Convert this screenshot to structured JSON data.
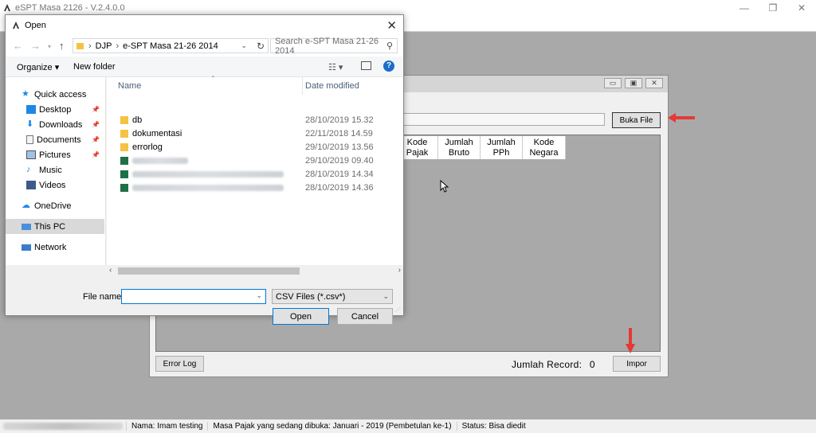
{
  "app": {
    "title": "eSPT Masa 2126 - V.2.4.0.0",
    "min_glyph": "—",
    "max_glyph": "❐",
    "close_glyph": "✕"
  },
  "import_window": {
    "min_glyph": "▭",
    "max_glyph": "▣",
    "close_glyph": "✕",
    "buka_file_label": "Buka File",
    "columns": [
      "Kode\nPajak",
      "Jumlah\nBruto",
      "Jumlah\nPPh",
      "Kode\nNegara"
    ],
    "error_log_label": "Error Log",
    "impor_label": "Impor",
    "record_label": "Jumlah Record:",
    "record_count": "0"
  },
  "dialog": {
    "title": "Open",
    "close_glyph": "✕",
    "breadcrumb": [
      "DJP",
      "e-SPT Masa 21-26 2014"
    ],
    "search_placeholder": "Search e-SPT Masa 21-26 2014",
    "toolbar": {
      "organize": "Organize ▾",
      "new_folder": "New folder"
    },
    "sidebar": [
      {
        "label": "Quick access",
        "icon": "star-icon",
        "pinned": false
      },
      {
        "label": "Desktop",
        "icon": "desktop-icon",
        "pinned": true
      },
      {
        "label": "Downloads",
        "icon": "download-icon",
        "pinned": true
      },
      {
        "label": "Documents",
        "icon": "documents-icon",
        "pinned": true
      },
      {
        "label": "Pictures",
        "icon": "pictures-icon",
        "pinned": true
      },
      {
        "label": "Music",
        "icon": "music-icon",
        "pinned": false
      },
      {
        "label": "Videos",
        "icon": "videos-icon",
        "pinned": false
      },
      {
        "label": "OneDrive",
        "icon": "cloud-icon",
        "pinned": false
      },
      {
        "label": "This PC",
        "icon": "computer-icon",
        "pinned": false,
        "selected": true
      },
      {
        "label": "Network",
        "icon": "network-icon",
        "pinned": false
      }
    ],
    "columns": {
      "name": "Name",
      "date": "Date modified"
    },
    "files": [
      {
        "name": "db",
        "date": "28/10/2019 15.32",
        "type": "folder"
      },
      {
        "name": "dokumentasi",
        "date": "22/11/2018 14.59",
        "type": "folder"
      },
      {
        "name": "errorlog",
        "date": "29/10/2019 13.56",
        "type": "folder"
      },
      {
        "name": "",
        "date": "29/10/2019 09.40",
        "type": "excel"
      },
      {
        "name": "",
        "date": "28/10/2019 14.34",
        "type": "excel"
      },
      {
        "name": "",
        "date": "28/10/2019 14.36",
        "type": "excel"
      }
    ],
    "filename_label": "File name:",
    "filename_value": "",
    "filetype_value": "CSV Files (*.csv*)",
    "open_label": "Open",
    "cancel_label": "Cancel",
    "colors": {
      "accent": "#0078d7",
      "folder": "#f5c242",
      "excel": "#1e7145"
    }
  },
  "statusbar": {
    "user": "Nama: Imam testing",
    "period": "Masa Pajak yang sedang dibuka: Januari - 2019 (Pembetulan ke-1)",
    "status": "Status: Bisa diedit"
  },
  "annotation": {
    "arrow_color": "#e53935"
  }
}
